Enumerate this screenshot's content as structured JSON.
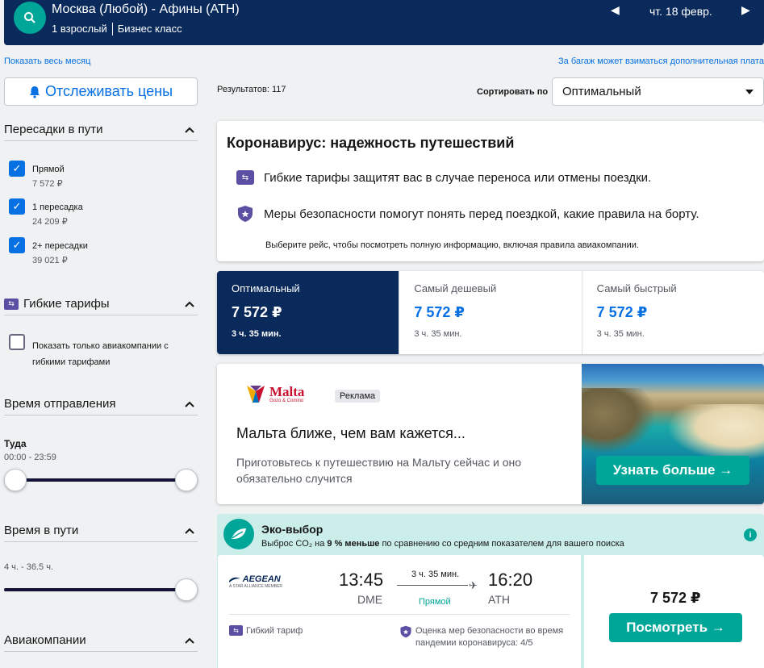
{
  "header": {
    "route": "Москва (Любой) - Афины (ATH)",
    "passengers": "1 взрослый",
    "cabin": "Бизнес класс",
    "date": "чт. 18 февр.",
    "prev_arrow": "◀",
    "next_arrow": "▶"
  },
  "links": {
    "show_month": "Показать весь месяц",
    "baggage_note": "За багаж может взиматься дополнительная плата"
  },
  "track_prices": {
    "label": "Отслеживать цены",
    "icon": "bell-icon"
  },
  "results": {
    "label": "Результатов: 117"
  },
  "sort": {
    "label": "Сортировать по",
    "selected": "Оптимальный"
  },
  "filters": {
    "stops": {
      "title": "Пересадки в пути",
      "options": [
        {
          "label": "Прямой",
          "price": "7 572 ₽",
          "checked": true
        },
        {
          "label": "1 пересадка",
          "price": "24 209 ₽",
          "checked": true
        },
        {
          "label": "2+ пересадки",
          "price": "39 021 ₽",
          "checked": true
        }
      ]
    },
    "flex": {
      "title": "Гибкие тарифы",
      "option_label": "Показать только авиакомпании с гибкими тарифами"
    },
    "departure": {
      "title": "Время отправления",
      "sub_label": "Туда",
      "range": "00:00 - 23:59"
    },
    "duration": {
      "title": "Время в пути",
      "range": "4 ч. - 36.5 ч."
    },
    "airlines": {
      "title": "Авиакомпании"
    }
  },
  "covid": {
    "title": "Коронавирус: надежность путешествий",
    "line1": "Гибкие тарифы защитят вас в случае переноса или отмены поездки.",
    "line2": "Меры безопасности помогут понять перед поездкой, какие правила на борту.",
    "note": "Выберите рейс, чтобы посмотреть полную информацию, включая правила авиакомпании."
  },
  "sort_tabs": [
    {
      "label": "Оптимальный",
      "price": "7 572 ₽",
      "duration": "3 ч. 35 мин."
    },
    {
      "label": "Самый дешевый",
      "price": "7 572 ₽",
      "duration": "3 ч. 35 мин."
    },
    {
      "label": "Самый быстрый",
      "price": "7 572 ₽",
      "duration": "3 ч. 35 мин."
    }
  ],
  "ad": {
    "brand": "Malta",
    "brand_sub": "Gozo & Comino",
    "badge": "Реклама",
    "title": "Мальта ближе, чем вам кажется...",
    "description": "Приготовьтесь к путешествию на Мальту сейчас и оно обязательно случится",
    "cta": "Узнать больше →"
  },
  "eco": {
    "title": "Эко-выбор",
    "sub_prefix": "Выброс CO₂ на ",
    "sub_bold": "9 % меньше",
    "sub_suffix": " по сравнению со средним показателем для вашего поиска",
    "info": "i"
  },
  "flight": {
    "airline": "AEGEAN",
    "airline_sub": "A STAR ALLIANCE MEMBER",
    "dep_time": "13:45",
    "dep_code": "DME",
    "arr_time": "16:20",
    "arr_code": "ATH",
    "duration": "3 ч. 35 мин.",
    "stops": "Прямой",
    "flex_tag": "Гибкий тариф",
    "safety": "Оценка мер безопасности во время пандемии коронавируса: 4/5",
    "price": "7 572 ₽",
    "view_btn": "Посмотреть →"
  },
  "colors": {
    "header_bg": "#0a2a5c",
    "accent_teal": "#00a698",
    "link_blue": "#0770e3",
    "flex_purple": "#5a4fa3"
  }
}
